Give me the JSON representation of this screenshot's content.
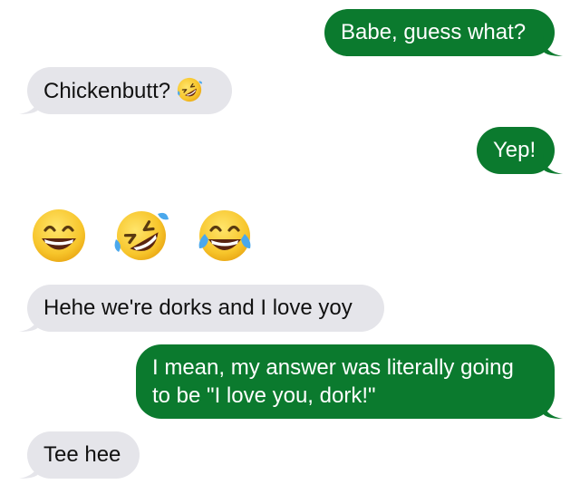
{
  "conversation": {
    "messages": [
      {
        "id": "m1",
        "direction": "sent",
        "text": "Babe, guess what?"
      },
      {
        "id": "m2",
        "direction": "received",
        "text": "Chickenbutt?",
        "emoji": "rolling-on-floor-laughing"
      },
      {
        "id": "m3",
        "direction": "sent",
        "text": "Yep!"
      },
      {
        "id": "m4",
        "direction": "received",
        "emoji_only": [
          "grinning-squinting",
          "rolling-on-floor-laughing",
          "tears-of-joy"
        ]
      },
      {
        "id": "m5",
        "direction": "received",
        "text": "Hehe we're dorks and I love yoy"
      },
      {
        "id": "m6",
        "direction": "sent",
        "lines": [
          "I mean, my answer was literally going",
          "to be \"I love you, dork!\""
        ]
      },
      {
        "id": "m7",
        "direction": "received",
        "text": "Tee hee"
      }
    ]
  },
  "colors": {
    "sent_bubble": "#0b7a2e",
    "received_bubble": "#e5e5ea",
    "sent_text": "#ffffff",
    "received_text": "#111111",
    "emoji_yellow": "#f7c52b"
  }
}
